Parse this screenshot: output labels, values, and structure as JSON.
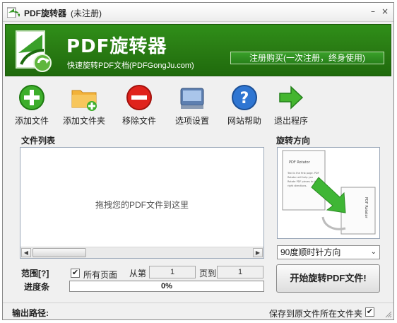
{
  "window": {
    "title": "PDF旋转器",
    "subtitle": "(未注册)"
  },
  "titlebar_buttons": {
    "minimize": "–",
    "close": "×"
  },
  "banner": {
    "brand": "PDF旋转器",
    "tagline": "快速旋转PDF文档(PDFGongJu.com)",
    "register_label": "注册购买(一次注册，终身使用)",
    "brand_color": "#2a7d14"
  },
  "toolbar": {
    "items": [
      {
        "label": "添加文件",
        "icon": "add-file-icon"
      },
      {
        "label": "添加文件夹",
        "icon": "add-folder-icon"
      },
      {
        "label": "移除文件",
        "icon": "remove-file-icon"
      },
      {
        "label": "选项设置",
        "icon": "settings-icon"
      },
      {
        "label": "网站帮助",
        "icon": "help-icon"
      },
      {
        "label": "退出程序",
        "icon": "exit-icon"
      }
    ]
  },
  "file_list": {
    "title": "文件列表",
    "hint": "拖拽您的PDF文件到这里"
  },
  "rotation": {
    "title": "旋转方向",
    "preview_page_title": "PDF Rotator",
    "preview_lines": [
      "Text is the first page. PDF",
      "Rotator will help you",
      "Rotate PDF pieces to the",
      "right directions."
    ],
    "selected_direction": "90度顺时针方向"
  },
  "range": {
    "label": "范围[?]",
    "all_pages_label": "所有页面",
    "all_pages_checked": true,
    "from_label": "从第",
    "from_value": "1",
    "to_label": "页到",
    "to_value": "1"
  },
  "progress": {
    "label": "进度条",
    "text": "0%",
    "value": 0
  },
  "start_button": "开始旋转PDF文件!",
  "status": {
    "output_label": "输出路径:",
    "save_same_folder_label": "保存到原文件所在文件夹",
    "save_same_folder_checked": true
  }
}
